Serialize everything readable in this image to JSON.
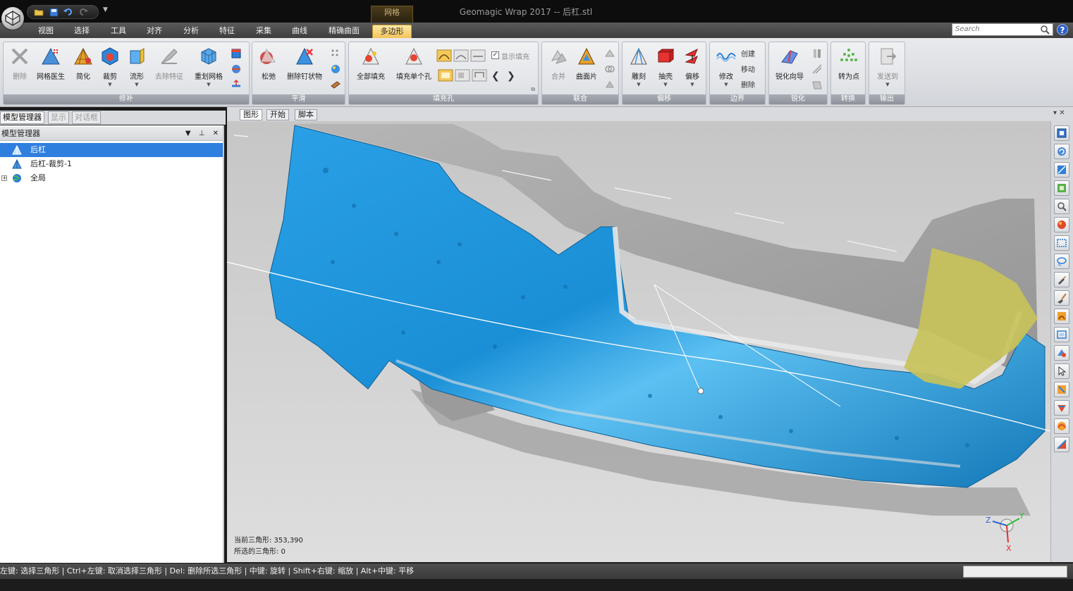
{
  "window": {
    "title": "Geomagic Wrap 2017 -- 后杠.stl",
    "context_group": "网格"
  },
  "ribbon_tabs": [
    {
      "label": "视图"
    },
    {
      "label": "选择"
    },
    {
      "label": "工具"
    },
    {
      "label": "对齐"
    },
    {
      "label": "分析"
    },
    {
      "label": "特征"
    },
    {
      "label": "采集"
    },
    {
      "label": "曲线"
    },
    {
      "label": "精确曲面"
    },
    {
      "label": "多边形",
      "active": true
    }
  ],
  "search": {
    "placeholder": "Search"
  },
  "help": "?",
  "ribbon_groups": {
    "repair": {
      "label": "修补",
      "buttons": [
        "删除",
        "网格医生",
        "简化",
        "裁剪",
        "流形",
        "去除特征",
        "重划网格"
      ]
    },
    "smooth": {
      "label": "平滑",
      "buttons": [
        "松弛",
        "删除钉状物"
      ]
    },
    "fill": {
      "label": "填充孔",
      "buttons": [
        "全部填充",
        "填充单个孔"
      ],
      "checkbox": "显示填充"
    },
    "combine": {
      "label": "联合",
      "buttons": [
        "合并",
        "曲面片"
      ]
    },
    "offset": {
      "label": "偏移",
      "buttons": [
        "雕刻",
        "抽壳",
        "偏移"
      ]
    },
    "boundary": {
      "label": "边界",
      "buttons": [
        "修改"
      ],
      "small": [
        "创建",
        "移动",
        "删除"
      ]
    },
    "sharpen": {
      "label": "锐化",
      "buttons": [
        "锐化向导"
      ]
    },
    "convert": {
      "label": "转换",
      "buttons": [
        "转为点"
      ]
    },
    "output": {
      "label": "输出",
      "buttons": [
        "发送到"
      ]
    }
  },
  "left_panel": {
    "tabs": [
      "模型管理器",
      "显示",
      "对话框"
    ],
    "header": "模型管理器",
    "tree": [
      "后杠",
      "后杠-裁剪-1",
      "全局"
    ]
  },
  "doc_tabs": [
    "图形",
    "开始",
    "脚本"
  ],
  "viewport": {
    "current_triangles_label": "当前三角形: 353,390",
    "selected_triangles_label": "所选的三角形: 0",
    "axes": {
      "x": "X",
      "y": "Y",
      "z": "Z"
    }
  },
  "status": {
    "hint": "左键: 选择三角形 | Ctrl+左键: 取消选择三角形 | Del: 删除所选三角形 | 中键: 旋转 | Shift+右键: 缩放 | Alt+中键: 平移"
  },
  "colors": {
    "model_blue": "#1a8fd6",
    "model_gray": "#a9a9a9",
    "selected_yellow": "#c8c25a",
    "tree_selected": "#2f7fde"
  }
}
